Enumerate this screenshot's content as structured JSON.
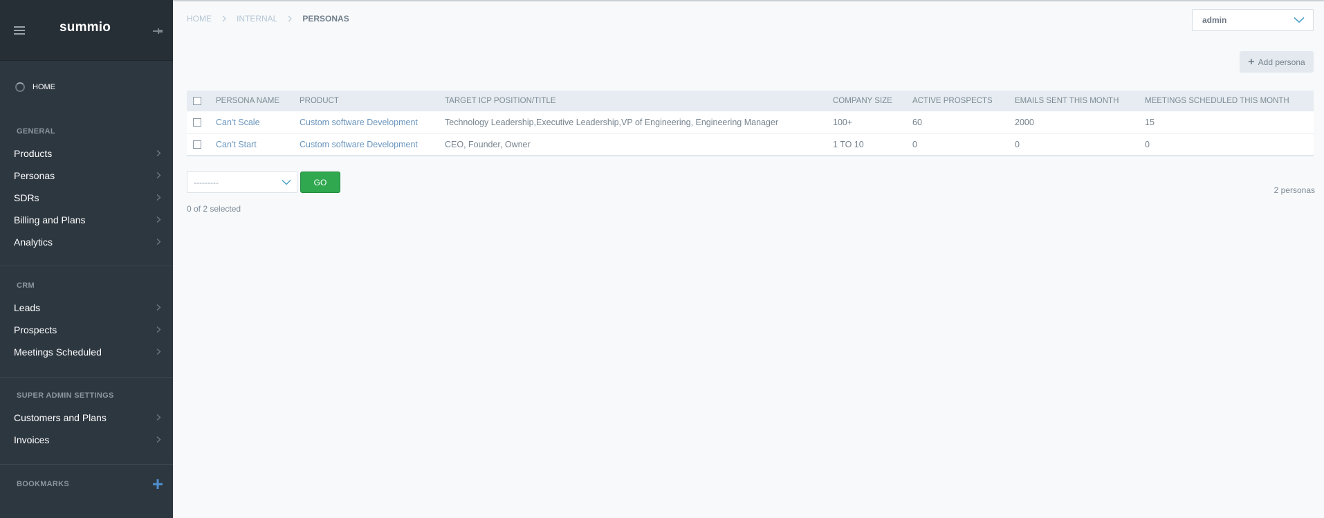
{
  "sidebar": {
    "logo": "summio",
    "home": "HOME",
    "sections": {
      "general": "GENERAL",
      "crm": "CRM",
      "super_admin": "SUPER ADMIN SETTINGS",
      "bookmarks": "BOOKMARKS"
    },
    "general_items": [
      "Products",
      "Personas",
      "SDRs",
      "Billing and Plans",
      "Analytics"
    ],
    "crm_items": [
      "Leads",
      "Prospects",
      "Meetings Scheduled"
    ],
    "admin_items": [
      "Customers and Plans",
      "Invoices"
    ]
  },
  "breadcrumb": {
    "home": "HOME",
    "internal": "INTERNAL",
    "current": "PERSONAS"
  },
  "user_select": {
    "value": "admin"
  },
  "toolbar": {
    "add_label": "Add persona"
  },
  "table": {
    "headers": [
      "PERSONA NAME",
      "PRODUCT",
      "TARGET ICP POSITION/TITLE",
      "COMPANY SIZE",
      "ACTIVE PROSPECTS",
      "EMAILS SENT THIS MONTH",
      "MEETINGS SCHEDULED THIS MONTH"
    ],
    "rows": [
      {
        "name": "Can't Scale",
        "product": "Custom software Development",
        "title": "Technology Leadership,Executive Leadership,VP of Engineering, Engineering Manager",
        "size": "100+",
        "active": "60",
        "emails": "2000",
        "meetings": "15"
      },
      {
        "name": "Can't Start",
        "product": "Custom software Development",
        "title": "CEO, Founder, Owner",
        "size": "1 TO 10",
        "active": "0",
        "emails": "0",
        "meetings": "0"
      }
    ]
  },
  "actions": {
    "select_value": "---------",
    "go_label": "GO",
    "selected_text": "0 of 2 selected",
    "count_text": "2 personas"
  }
}
